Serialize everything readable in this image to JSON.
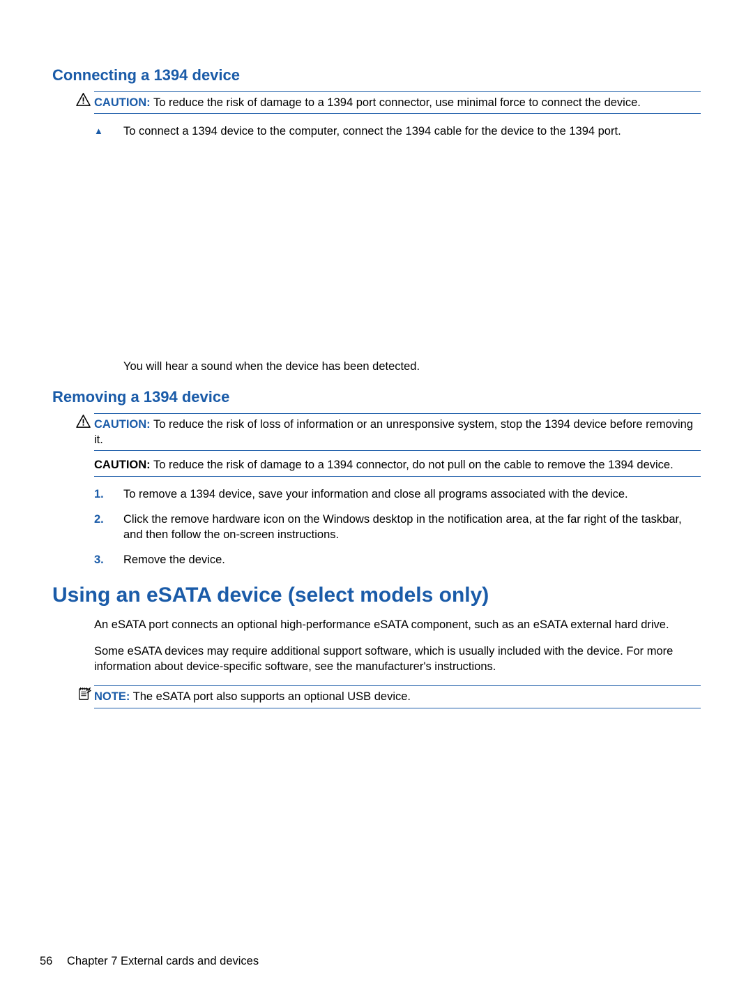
{
  "section1": {
    "heading": "Connecting a 1394 device",
    "caution": {
      "label": "CAUTION:",
      "text": "To reduce the risk of damage to a 1394 port connector, use minimal force to connect the device."
    },
    "step": "To connect a 1394 device to the computer, connect the 1394 cable for the device to the 1394 port.",
    "after_image": "You will hear a sound when the device has been detected."
  },
  "section2": {
    "heading": "Removing a 1394 device",
    "caution1": {
      "label": "CAUTION:",
      "text": "To reduce the risk of loss of information or an unresponsive system, stop the 1394 device before removing it."
    },
    "caution2": {
      "label": "CAUTION:",
      "text": "To reduce the risk of damage to a 1394 connector, do not pull on the cable to remove the 1394 device."
    },
    "steps": {
      "s1": {
        "marker": "1.",
        "text": "To remove a 1394 device, save your information and close all programs associated with the device."
      },
      "s2": {
        "marker": "2.",
        "text": "Click the remove hardware icon on the Windows desktop in the notification area, at the far right of the taskbar, and then follow the on-screen instructions."
      },
      "s3": {
        "marker": "3.",
        "text": "Remove the device."
      }
    }
  },
  "section3": {
    "heading": "Using an eSATA device (select models only)",
    "p1": "An eSATA port connects an optional high-performance eSATA component, such as an eSATA external hard drive.",
    "p2": "Some eSATA devices may require additional support software, which is usually included with the device. For more information about device-specific software, see the manufacturer's instructions.",
    "note": {
      "label": "NOTE:",
      "text": "The eSATA port also supports an optional USB device."
    }
  },
  "footer": {
    "page_number": "56",
    "chapter": "Chapter 7   External cards and devices"
  }
}
